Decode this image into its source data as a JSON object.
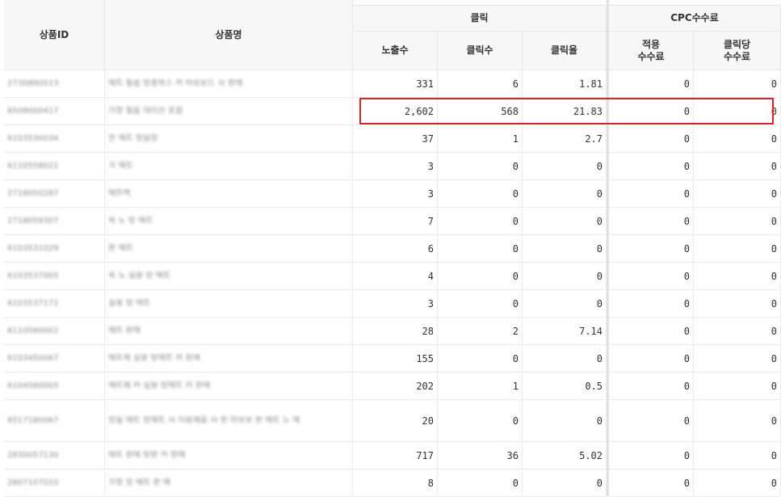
{
  "table": {
    "headers": {
      "product_id": "상품ID",
      "product_name": "상품명",
      "click_group": "클릭",
      "cpc_group": "CPC수수료",
      "impressions": "노출수",
      "clicks": "클릭수",
      "ctr": "클릭율",
      "applied_fee": "적용\n수수료",
      "fee_per_click": "클릭당\n수수료"
    },
    "rows": [
      {
        "id": "2730890513",
        "name": "매트 필름 방풍박스 커 마보보드 사 판매",
        "impressions": "331",
        "clicks": "6",
        "ctr": "1.81",
        "applied_fee": "0",
        "fee_per_click": "0"
      },
      {
        "id": "6508000417",
        "name": "가정 필름 대리선 포함",
        "impressions": "2,602",
        "clicks": "568",
        "ctr": "21.83",
        "applied_fee": "0",
        "fee_per_click": "0"
      },
      {
        "id": "6103530034",
        "name": "한 매트 방음장",
        "impressions": "37",
        "clicks": "1",
        "ctr": "2.7",
        "applied_fee": "0",
        "fee_per_click": "0"
      },
      {
        "id": "6110558021",
        "name": "가 매트",
        "impressions": "3",
        "clicks": "0",
        "ctr": "0",
        "applied_fee": "0",
        "fee_per_click": "0"
      },
      {
        "id": "2718050287",
        "name": "매트백",
        "impressions": "3",
        "clicks": "0",
        "ctr": "0",
        "applied_fee": "0",
        "fee_per_click": "0"
      },
      {
        "id": "2718059307",
        "name": "욕 노 방 매트",
        "impressions": "7",
        "clicks": "0",
        "ctr": "0",
        "applied_fee": "0",
        "fee_per_click": "0"
      },
      {
        "id": "6103531029",
        "name": "판 매트",
        "impressions": "6",
        "clicks": "0",
        "ctr": "0",
        "applied_fee": "0",
        "fee_per_click": "0"
      },
      {
        "id": "6103537005",
        "name": "욕 노 실용 방 매트",
        "impressions": "4",
        "clicks": "0",
        "ctr": "0",
        "applied_fee": "0",
        "fee_per_click": "0"
      },
      {
        "id": "6103537171",
        "name": "실용 방 매트",
        "impressions": "3",
        "clicks": "0",
        "ctr": "0",
        "applied_fee": "0",
        "fee_per_click": "0"
      },
      {
        "id": "6110560002",
        "name": "매트 판매",
        "impressions": "28",
        "clicks": "2",
        "ctr": "7.14",
        "applied_fee": "0",
        "fee_per_click": "0"
      },
      {
        "id": "6103450067",
        "name": "매트제 실용 방매트 커 판매",
        "impressions": "155",
        "clicks": "0",
        "ctr": "0",
        "applied_fee": "0",
        "fee_per_click": "0"
      },
      {
        "id": "6104560005",
        "name": "매트제 커 실용 방매트 커 판매",
        "impressions": "202",
        "clicks": "1",
        "ctr": "0.5",
        "applied_fee": "0",
        "fee_per_click": "0"
      },
      {
        "id": "6517180067",
        "name": "방음 매트 방매트 사 미용재료 사 판 마보보 판 매트 노 매",
        "impressions": "20",
        "clicks": "0",
        "ctr": "0",
        "applied_fee": "0",
        "fee_per_click": "0"
      },
      {
        "id": "2830057130",
        "name": "매트 판매 방판 커 판매",
        "impressions": "717",
        "clicks": "36",
        "ctr": "5.02",
        "applied_fee": "0",
        "fee_per_click": "0"
      },
      {
        "id": "2807107010",
        "name": "가정 방 매트 판 매",
        "impressions": "8",
        "clicks": "0",
        "ctr": "0",
        "applied_fee": "0",
        "fee_per_click": "0"
      }
    ]
  }
}
